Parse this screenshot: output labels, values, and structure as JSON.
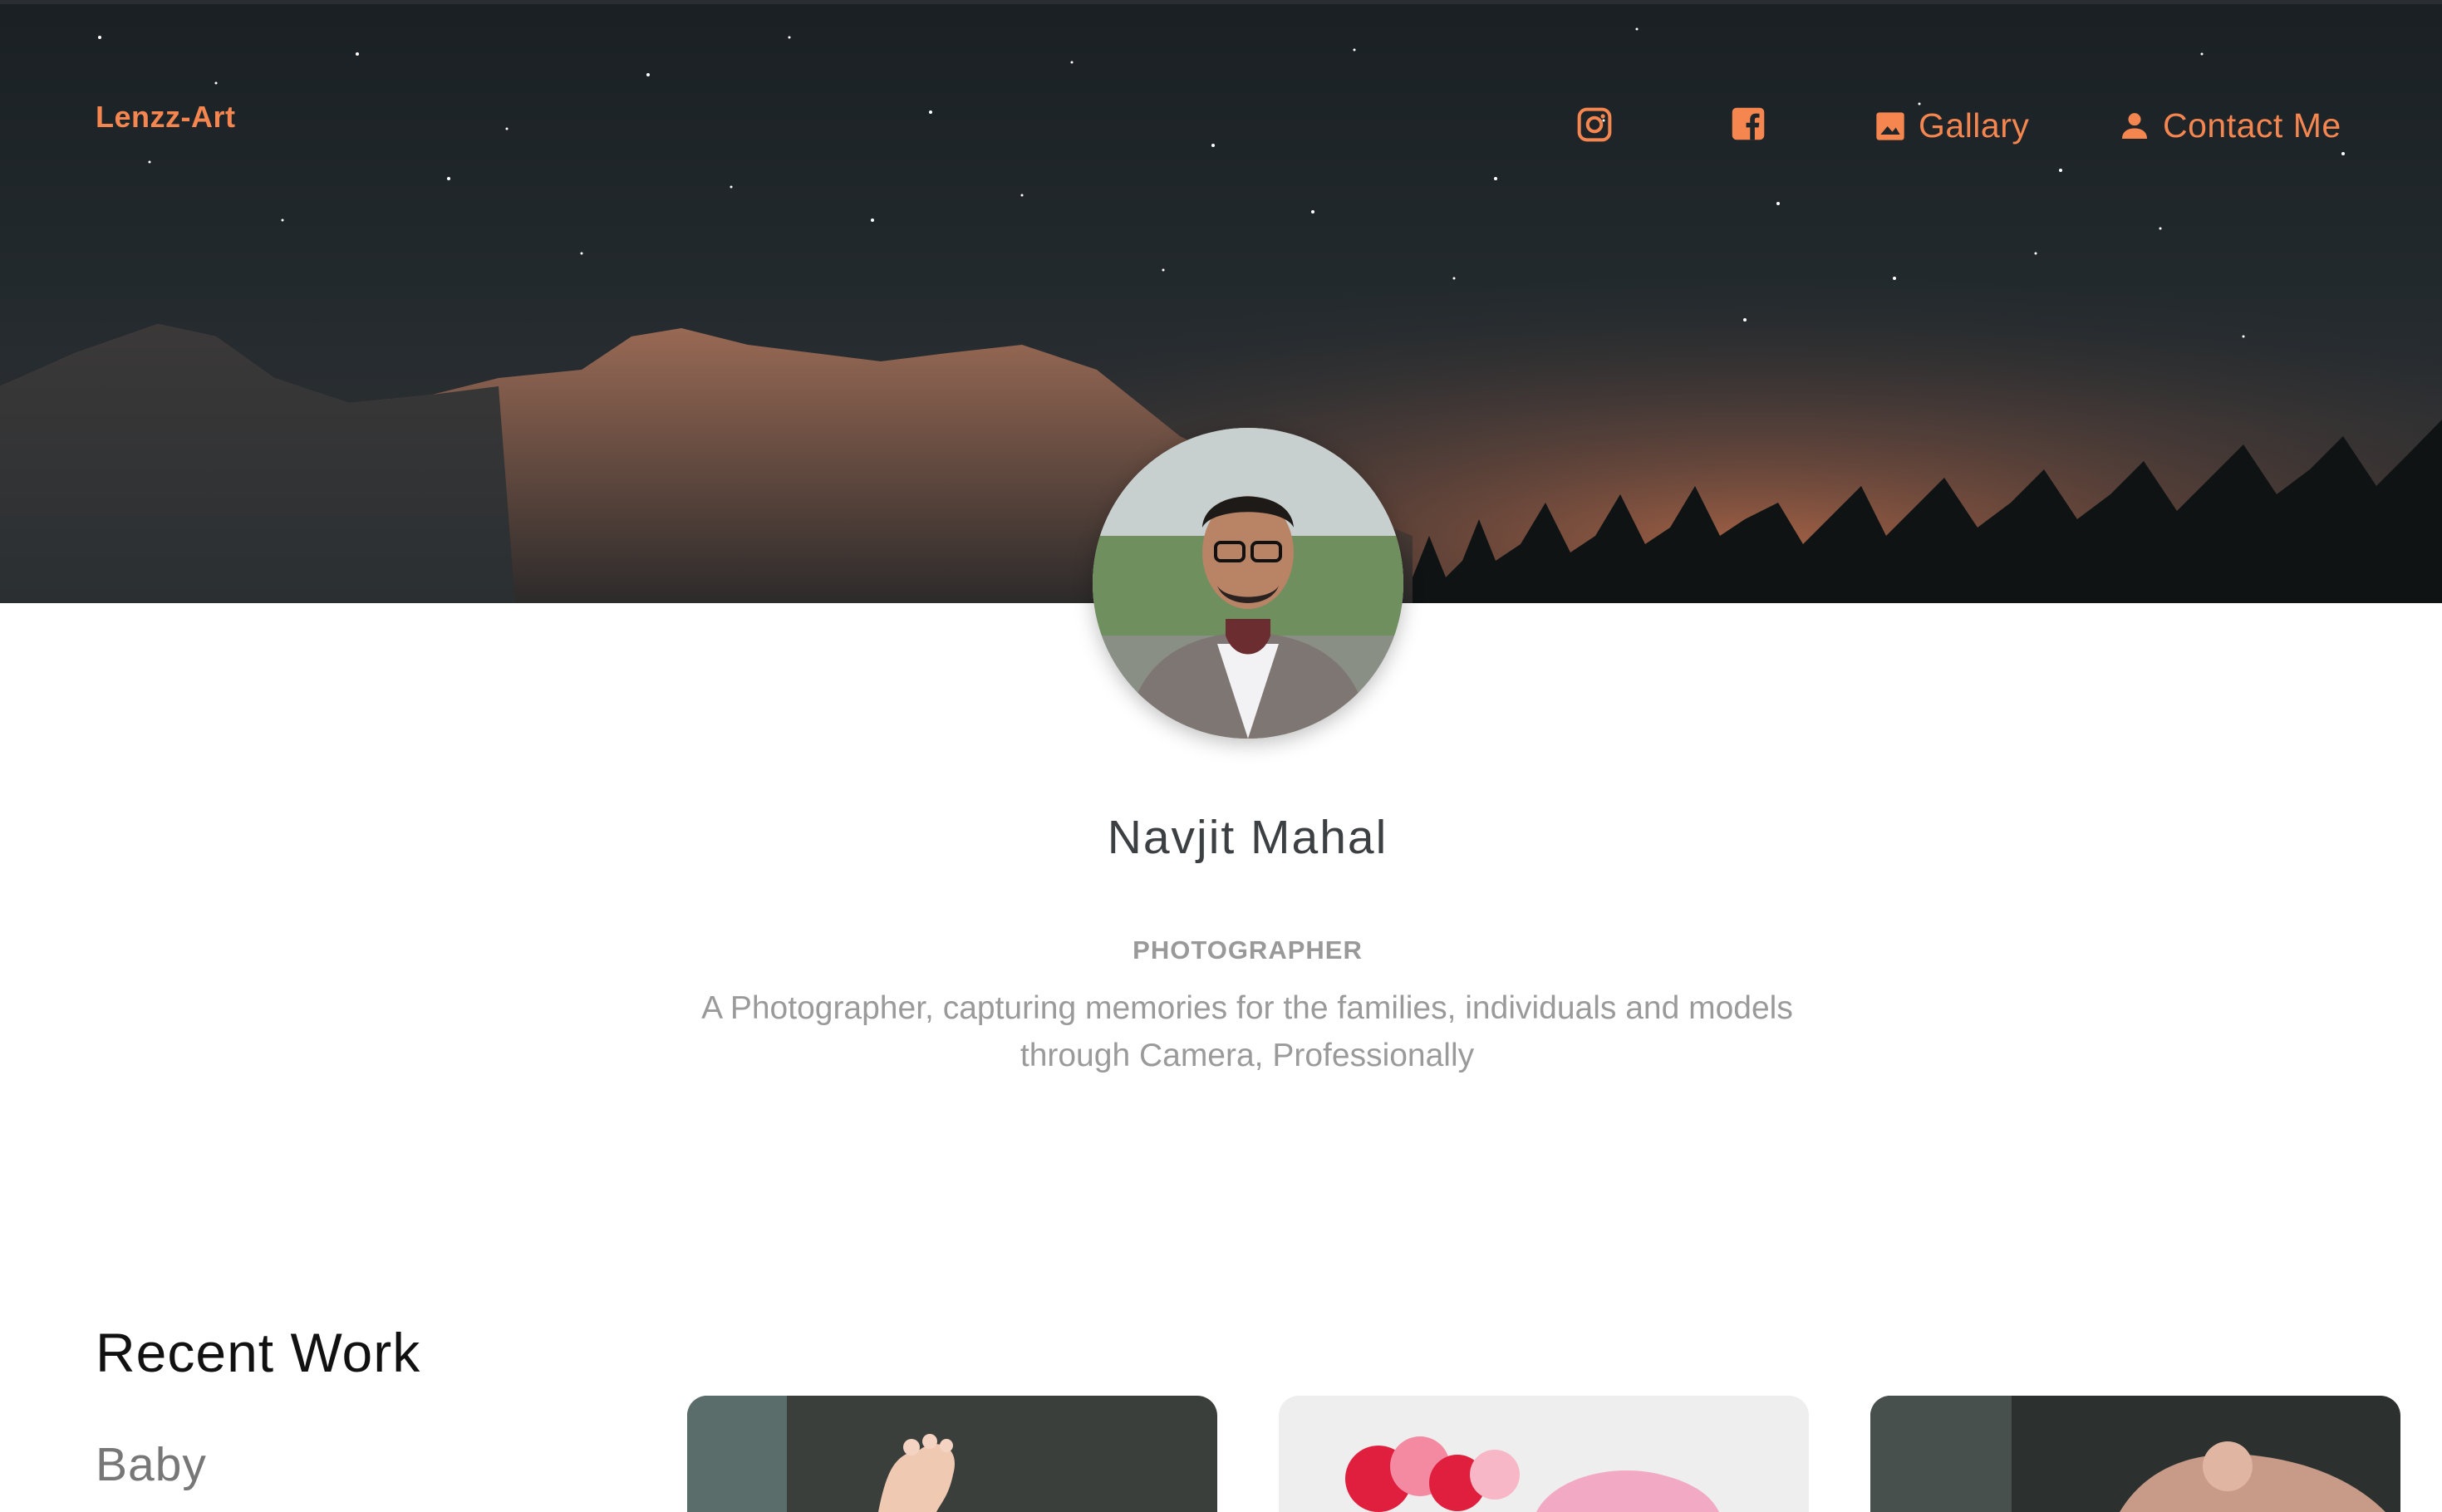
{
  "brand": {
    "name": "Lenzz-Art"
  },
  "nav": {
    "instagram_icon": "instagram-icon",
    "facebook_icon": "facebook-icon",
    "gallery_label": "Gallary",
    "gallery_icon": "image-icon",
    "contact_label": "Contact Me",
    "contact_icon": "person-icon"
  },
  "profile": {
    "name": "Navjit Mahal",
    "role": "PHOTOGRAPHER",
    "bio": "A Photographer, capturing memories for the families, individuals and models through Camera, Professionally"
  },
  "recent": {
    "title": "Recent Work",
    "category": "Baby"
  },
  "colors": {
    "accent": "#f5864f",
    "hero_dark": "#1f2528"
  }
}
